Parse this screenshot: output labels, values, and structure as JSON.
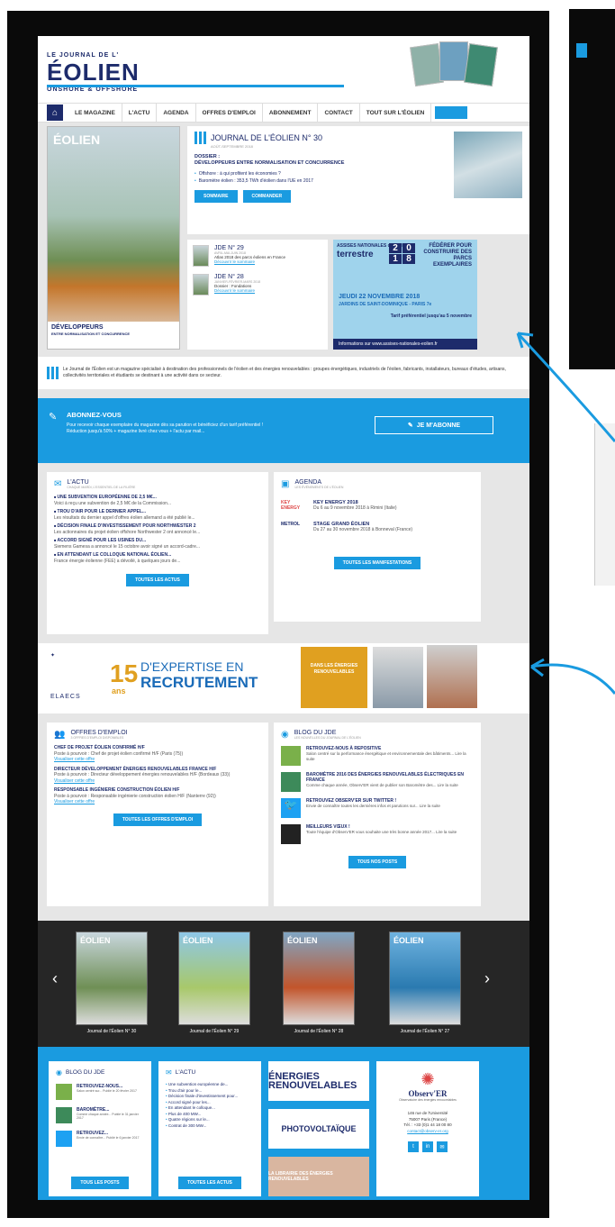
{
  "colors": {
    "accent": "#1a9be0",
    "brand_dark": "#1d2b6b",
    "frame": "#0a0a0a",
    "gold": "#e0a020"
  },
  "header": {
    "logo_text": "ÉOLIEN",
    "logo_sub": "ONSHORE & OFFSHORE",
    "logo_prefix": "LE JOURNAL DE L'"
  },
  "nav": {
    "home_icon": "home-icon",
    "items": [
      "LE MAGAZINE",
      "L'ACTU",
      "AGENDA",
      "OFFRES D'EMPLOI",
      "ABONNEMENT",
      "CONTACT",
      "TOUT SUR L'ÉOLIEN"
    ]
  },
  "hero": {
    "cover_title": "ÉOLIEN",
    "cover_bottom_title": "DÉVELOPPEURS",
    "cover_bottom_sub": "ENTRE NORMALISATION ET CONCURRENCE",
    "journal_title": "JOURNAL DE L'ÉOLIEN N° 30",
    "journal_date": "AOÛT-SEPTEMBRE 2018",
    "dossier_label": "DOSSIER :",
    "dossier_text": "DÉVELOPPEURS ENTRE NORMALISATION ET CONCURRENCE",
    "bullets": [
      "Offshore : à qui profitent les économies ?",
      "Baromètre éolien : 353,5 TWh d'éolien dans l'UE en 2017"
    ],
    "btn_summary": "SOMMAIRE",
    "btn_order": "COMMANDER"
  },
  "jde": [
    {
      "title": "JDE N° 29",
      "date": "AVRIL-MAI-JUIN 2018",
      "subject": "Atlas 2018 des parcs éoliens en France",
      "link": "Découvrir le sommaire"
    },
    {
      "title": "JDE N° 28",
      "date": "JANVIER-FÉVRIER-MARS 2018",
      "subject": "Dossier : Fondations",
      "link": "Découvrir le sommaire"
    }
  ],
  "ad": {
    "assises": "ASSISES NATIONALES de l'éolien",
    "terrestre": "terrestre",
    "year": [
      "2",
      "0",
      "1",
      "8"
    ],
    "right": "FÉDÉRER POUR CONSTRUIRE DES PARCS EXEMPLAIRES",
    "date": "JEUDI 22 NOVEMBRE 2018",
    "place": "JARDINS DE SAINT-DOMINIQUE - PARIS 7e",
    "tarif": "Tarif préférentiel jusqu'au 5 novembre",
    "footer": "Informations sur www.assises-nationales-eolien.fr"
  },
  "intro": "Le Journal de l'Éolien est un magazine spécialisé à destination des professionnels de l'éolien et des énergies renouvelables : groupes énergétiques, industriels de l'éolien, fabricants, installateurs, bureaux d'études, artisans, collectivités territoriales et étudiants se destinant à une activité dans ce secteur.",
  "subscribe": {
    "title": "ABONNEZ-VOUS",
    "text": "Pour recevoir chaque exemplaire du magazine dès sa parution et bénéficiez d'un tarif préférentiel ! Réduction jusqu'à 50% + magazine livré chez vous + l'actu par mail...",
    "button": "JE M'ABONNE"
  },
  "actu": {
    "title": "L'ACTU",
    "subtitle": "CHAQUE MARDI, L'ESSENTIEL DE LA FILIÈRE",
    "items": [
      {
        "h": "UNE SUBVENTION EUROPÉENNE DE 2,5 M€...",
        "b": "Voici à reçu une subvention de 2,5 M€ de la Commission..."
      },
      {
        "h": "TROU D'AIR POUR LE DERNIER APPEL...",
        "b": "Les résultats du dernier appel d'offres éolien allemand a été publié le..."
      },
      {
        "h": "DÉCISION FINALE D'INVESTISSEMENT POUR NORTHWESTER 2",
        "b": "Les actionnaires du projet éolien offshore Northwester 2 ont annoncé le..."
      },
      {
        "h": "ACCORD SIGNÉ POUR LES USINES DU...",
        "b": "Siemens Gamesa a annoncé le 15 octobre avoir signé un accord-cadre..."
      },
      {
        "h": "EN ATTENDANT LE COLLOQUE NATIONAL ÉOLIEN...",
        "b": "France énergie éolienne (FEE) a dévoilé, à quelques jours de..."
      }
    ],
    "button": "TOUTES LES ACTUS"
  },
  "agenda": {
    "title": "AGENDA",
    "subtitle": "LES ÉVÉNEMENTS DE L'ÉOLIEN",
    "events": [
      {
        "logo": "KEY ENERGY",
        "t": "KEY ENERGY 2018",
        "d": "Du 6 au 9 novembre 2018 à Rimini (Italie)"
      },
      {
        "logo": "METROL",
        "t": "STAGE GRAND ÉOLIEN",
        "d": "Du 27 au 30 novembre 2018 à Bonneval (France)"
      }
    ],
    "button": "TOUTES LES MANIFESTATIONS"
  },
  "recruit": {
    "brand": "ELAECS",
    "num": "15",
    "ans": "ans",
    "expertise": "D'EXPERTISE EN",
    "recrutement": "RECRUTEMENT",
    "gold_text": "DANS LES ÉNERGIES RENOUVELABLES"
  },
  "offres": {
    "title": "OFFRES D'EMPLOI",
    "subtitle": "3 OFFRES D'EMPLOI DISPONIBLES",
    "items": [
      {
        "h": "CHEF DE PROJET ÉOLIEN CONFIRMÉ H/F",
        "b": "Poste à pourvoir : Chef de projet éolien confirmé H/F (Paris (75))",
        "l": "Visualiser cette offre"
      },
      {
        "h": "DIRECTEUR DÉVELOPPEMENT ÉNERGIES RENOUVELABLES FRANCE H/F",
        "b": "Poste à pourvoir : Directeur développement énergies renouvelables H/F (Bordeaux (33))",
        "l": "Visualiser cette offre"
      },
      {
        "h": "RESPONSABLE INGÉNIERIE CONSTRUCTION ÉOLIEN H/F",
        "b": "Poste à pourvoir : Responsable ingénierie construction éolien H/F (Nanterre (92))",
        "l": "Visualiser cette offre"
      }
    ],
    "button": "TOUTES LES OFFRES D'EMPLOI"
  },
  "blog": {
    "title": "BLOG DU JDE",
    "subtitle": "LES NOUVELLES DU JOURNAL DE L'ÉOLIEN",
    "posts": [
      {
        "t": "RETROUVEZ-NOUS À REPOSITIVE",
        "d": "Salon centré sur la performance énergétique et environnementale des bâtiments... Lire la suite"
      },
      {
        "t": "BAROMÈTRE 2016 DES ÉNERGIES RENOUVELABLES ÉLECTRIQUES EN FRANCE",
        "d": "Comme chaque année, Observ'ER vient de publier son Baromètre des... Lire la suite"
      },
      {
        "t": "RETROUVEZ OBSERV'ER SUR TWITTER !",
        "d": "Envie de connaître toutes les dernières infos et parutions sur... Lire la suite"
      },
      {
        "t": "MEILLEURS VŒUX !",
        "d": "Toute l'équipe d'Observ'ER vous souhaite une très bonne année 2017... Lire la suite"
      }
    ],
    "button": "TOUS NOS POSTS"
  },
  "carousel": {
    "covers": [
      {
        "title": "ÉOLIEN",
        "caption": "Journal de l'Éolien N° 30"
      },
      {
        "title": "ÉOLIEN",
        "caption": "Journal de l'Éolien N° 29"
      },
      {
        "title": "ÉOLIEN",
        "caption": "Journal de l'Éolien N° 28"
      },
      {
        "title": "ÉOLIEN",
        "caption": "Journal de l'Éolien N° 27"
      }
    ]
  },
  "footer": {
    "blog_title": "BLOG DU JDE",
    "blog_posts": [
      {
        "a": "RETROUVEZ-NOUS...",
        "b": "Salon centré sur... Publié le 20 février 2017"
      },
      {
        "a": "BAROMÈTRE...",
        "b": "Comme chaque année... Publié le 31 janvier 2017"
      },
      {
        "a": "RETROUVEZ...",
        "b": "Envie de connaître... Publié le 6 janvier 2017"
      }
    ],
    "blog_button": "TOUS LES POSTS",
    "actu_title": "L'ACTU",
    "actu_items": [
      "Une subvention européenne de...",
      "Trou d'air pour le...",
      "Décision finale d'investissement pour...",
      "Accord signé pour les...",
      "En attendant le colloque...",
      "Plus de 400 MW...",
      "Quatre régions sur le...",
      "Contrat de 300 MW..."
    ],
    "actu_button": "TOUTES LES ACTUS",
    "logo_energies": "ÉNERGIES RENOUVELABLES",
    "logo_photo": "PHOTOVOLTAÏQUE",
    "logo_librairie": "LA LIBRAIRIE DES ÉNERGIES RENOUVELABLES",
    "obs_name": "Observ'ER",
    "obs_sub": "Observatoire des énergies renouvelables",
    "obs_addr1": "146 rue de l'Université",
    "obs_addr2": "75007 Paris (France)",
    "obs_tel": "Tél. : +33 (0)1 44 18 00 80",
    "obs_mail": "contact@observ-er.org",
    "social": [
      "t",
      "in",
      "✉"
    ]
  }
}
